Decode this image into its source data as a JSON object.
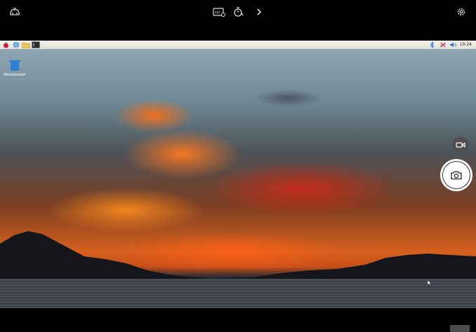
{
  "toolbar": {
    "left_icon": "remote-control-icon",
    "center_icons": [
      "hdr-icon",
      "timer-icon",
      "chevron-right-icon"
    ],
    "right_icon": "gear-icon"
  },
  "desktop": {
    "taskbar": {
      "left_icons": [
        "raspberry-menu-icon",
        "browser-icon",
        "file-manager-icon",
        "terminal-icon"
      ],
      "tray_icons": [
        "bluetooth-icon",
        "network-disconnected-icon",
        "volume-icon"
      ],
      "clock": "10:24"
    },
    "icons": [
      {
        "label": "Wastebasket",
        "icon": "trash-icon"
      }
    ]
  },
  "camera": {
    "video_mode_icon": "video-icon",
    "shutter_icon": "camera-icon"
  },
  "colors": {
    "accent": "#ffffff",
    "panel": "#000000",
    "taskbar": "#eeece6"
  }
}
